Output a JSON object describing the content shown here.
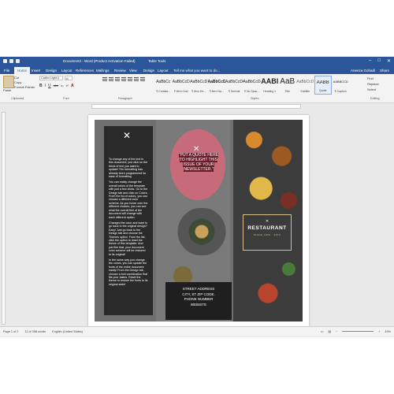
{
  "window": {
    "title": "Document2 - Word (Product Activation Failed)",
    "context_tab": "Table Tools",
    "controls": [
      "–",
      "□",
      "✕"
    ]
  },
  "tabs": [
    "File",
    "Home",
    "Insert",
    "Design",
    "Layout",
    "References",
    "Mailings",
    "Review",
    "View",
    "Design",
    "Layout"
  ],
  "active_tab": "Home",
  "tell_me": "Tell me what you want to do...",
  "user": "Aneeza Gohadi",
  "share": "Share",
  "clipboard": {
    "paste": "Paste",
    "cut": "Cut",
    "copy": "Copy",
    "format_painter": "Format Painter",
    "group": "Clipboard"
  },
  "font": {
    "name": "Calibri Light (I",
    "size": "11",
    "group": "Font",
    "buttons": [
      "B",
      "I",
      "U",
      "abc",
      "x₂",
      "x²",
      "A"
    ]
  },
  "paragraph": {
    "group": "Paragraph"
  },
  "styles": {
    "group": "Styles",
    "items": [
      {
        "sample": "AaBbCc",
        "name": "¶ Contact..."
      },
      {
        "sample": "AaBbCcD",
        "name": "¶ Item Cost"
      },
      {
        "sample": "AaBbCcD",
        "name": "¶ Item De..."
      },
      {
        "sample": "AaBbCcD",
        "name": "¶ Item Na..."
      },
      {
        "sample": "AaBbCcDc",
        "name": "¶ Normal"
      },
      {
        "sample": "AaBbCcDc",
        "name": "¶ No Spac..."
      },
      {
        "sample": "AABI",
        "name": "Heading 1"
      },
      {
        "sample": "AaB",
        "name": "Title"
      },
      {
        "sample": "AaBbCcD",
        "name": "Subtitle"
      },
      {
        "sample": "AABB",
        "name": "Quote"
      },
      {
        "sample": "AABBCCD",
        "name": "¶ Caption"
      }
    ]
  },
  "editing": {
    "find": "Find",
    "replace": "Replace",
    "select": "Select",
    "group": "Editing"
  },
  "brochure": {
    "body": [
      "To change any of the text in this document, just click on the block of text you want to update! The formatting has already been programmed for ease of formatting.",
      "You can easily change the overall colors of the template with just a few clicks. Go to the Design tab and click on Colors. From the list of colors, you can choose a different color scheme. As you hover over the different choices, you can see what the overall feel of the document will change with each different option.",
      "Changed the color and want to go back to the original design? Easy! Just go back to the Design tab and choose the Themes option. From the list, click the option to reset the theme of this template. And just like that, your document color scheme will be restored to its original!",
      "In the same way you change the colors, you can update the fonts of the entire document easily! From the Design tab, choose a font combination that fits your tastes. Reset the theme to restore the fonts to its original state!"
    ],
    "quote": "\"PUT A QUOTE HERE TO HIGHLIGHT THIS ISSUE OF YOUR NEWSLETTER.\"",
    "restaurant": "RESTAURANT",
    "tagline": "SINCE 1950 · 2016",
    "address": [
      "STREET ADDRESS",
      "CITY, ST ZIP CODE.",
      "PHONE NUMBER",
      "WEBSITE"
    ]
  },
  "status": {
    "page": "Page 1 of 2",
    "words": "11 of 358 words",
    "language": "English (United States)",
    "zoom": "49%"
  },
  "colors": {
    "titlebar": "#2b579a",
    "quote_circle": "#c76b7a",
    "dark_panel": "#2a2a2a"
  }
}
